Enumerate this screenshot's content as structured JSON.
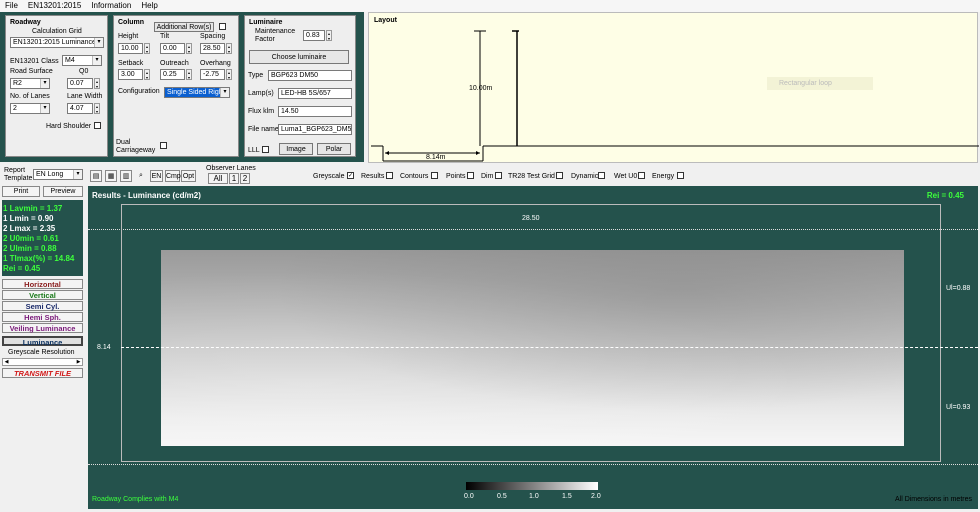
{
  "menu": [
    "File",
    "EN13201:2015",
    "Information",
    "Help"
  ],
  "roadway": {
    "title": "Roadway",
    "calc_grid_label": "Calculation Grid",
    "calc_grid_value": "EN13201:2015 Luminance",
    "class_label": "EN13201 Class",
    "class_value": "M4",
    "road_surface_label": "Road Surface",
    "q0_label": "Q0",
    "road_surface_value": "R2",
    "q0_value": "0.07",
    "lanes_label": "No. of Lanes",
    "lane_width_label": "Lane Width",
    "lanes_value": "2",
    "lane_width_value": "4.07",
    "hard_shoulder_label": "Hard Shoulder"
  },
  "column": {
    "title": "Column",
    "additional_rows_label": "Additional Row(s)",
    "height_label": "Height",
    "tilt_label": "Tilt",
    "spacing_label": "Spacing",
    "height_value": "10.00",
    "tilt_value": "0.00",
    "spacing_value": "28.50",
    "setback_label": "Setback",
    "outreach_label": "Outreach",
    "overhang_label": "Overhang",
    "setback_value": "3.00",
    "outreach_value": "0.25",
    "overhang_value": "-2.75",
    "configuration_label": "Configuration",
    "configuration_value": "Single Sided Right",
    "dual_label": "Dual Carriageway"
  },
  "luminaire": {
    "title": "Luminaire",
    "maintenance_label": "Maintenance Factor",
    "maintenance_value": "0.83",
    "choose_label": "Choose luminaire",
    "type_label": "Type",
    "type_value": "BGP623 DM50",
    "lamps_label": "Lamp(s)",
    "lamps_value": "LED-HB 5S/657",
    "flux_label": "Flux klm",
    "flux_value": "14.50",
    "file_label": "File name",
    "file_value": "Luma1_BGP623_DM50",
    "lll_label": "LLL",
    "image_label": "Image",
    "polar_label": "Polar"
  },
  "layout": {
    "title": "Layout",
    "height_text": "10.00m",
    "width_text": "8.14m",
    "overlay_text": "Rectangular loop"
  },
  "toolbar": {
    "report_label": "Report Template",
    "report_value": "EN Long",
    "en": "EN",
    "cmp": "Cmp",
    "opt": "Opt",
    "observer_label": "Observer Lanes",
    "observer_all": "All",
    "observer_1": "1",
    "observer_2": "2",
    "toggles": [
      "Greyscale",
      "Results",
      "Contours",
      "Points",
      "Dim",
      "TR28 Test Grid",
      "Dynamic",
      "Wet U0",
      "Energy"
    ]
  },
  "side": {
    "print": "Print",
    "preview": "Preview",
    "stats": [
      "1 Lavmin    =   1.37",
      "1 Lmin        =   0.90",
      "2 Lmax        =   2.35",
      "2 U0min       =   0.61",
      "2 Ulmin       =   0.88",
      "1 TImax(%)  = 14.84",
      "   Rei         =   0.45"
    ],
    "buttons": [
      "Horizontal",
      "Vertical",
      "Semi Cyl.",
      "Hemi Sph.",
      "Veiling Luminance",
      "Luminance"
    ],
    "greyscale_label": "Greyscale Resolution",
    "transmit": "TRANSMIT FILE"
  },
  "results": {
    "title": "Results - Luminance (cd/m2)",
    "rei": "Rei  =  0.45",
    "spacing": "28.50",
    "width": "8.14",
    "ul1": "Ul=0.88",
    "ul2": "Ul=0.93",
    "compliance": "Roadway Complies with M4",
    "dims": "All Dimensions in metres",
    "scale": [
      "0.0",
      "0.5",
      "1.0",
      "1.5",
      "2.0"
    ]
  },
  "colors": {
    "panel": "#24524c",
    "green": "#3cff3c",
    "layout_bg": "#fefee6"
  }
}
